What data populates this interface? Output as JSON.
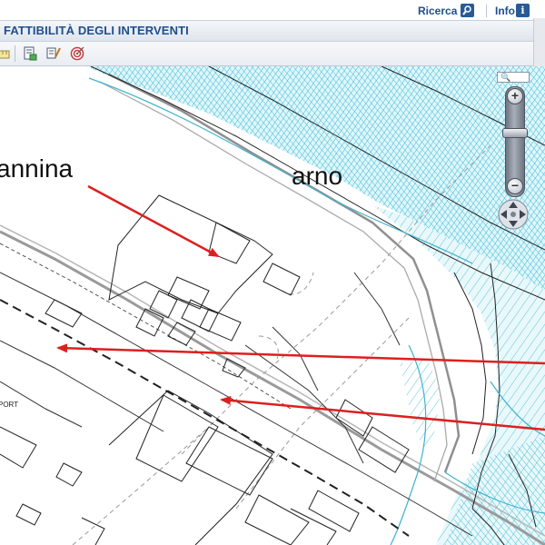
{
  "header": {
    "search_label": "Ricerca",
    "info_label": "Info",
    "title": "FATTIBILITÀ DEGLI INTERVENTI"
  },
  "toolbar": {
    "tools": [
      "measure-tool-icon",
      "report-tool-icon",
      "query-tool-icon",
      "target-tool-icon"
    ]
  },
  "map": {
    "annotations": {
      "left_label": "annina",
      "river_label": "arno",
      "feature_label": "PORT"
    },
    "colors": {
      "river_hatch": "#35b8d2",
      "river_fill": "#dff6fb",
      "annotation_arrow": "#dd1f1f",
      "linework": "#222222"
    }
  },
  "zoom": {
    "search_placeholder": "",
    "zoom_in_label": "+",
    "zoom_out_label": "−"
  }
}
